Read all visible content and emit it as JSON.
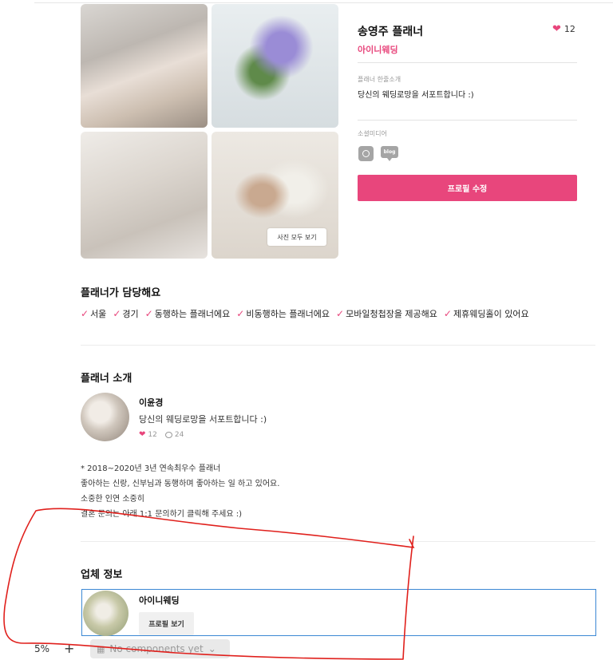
{
  "profile": {
    "planner_name": "송영주 플래너",
    "like_count": "12",
    "company_name": "아이니웨딩",
    "intro_label": "플래너 한줄소개",
    "intro_text": "당신의 웨딩로망을 서포트합니다 :)",
    "social_label": "소셜미디어",
    "blog_icon_text": "blog",
    "edit_button": "프로필 수정"
  },
  "gallery": {
    "view_all_button": "사진 모두 보기"
  },
  "service": {
    "title": "플래너가 담당해요",
    "tags": [
      "서울",
      "경기",
      "동행하는 플래너에요",
      "비동행하는 플래너에요",
      "모바일청첩장을 제공해요",
      "제휴웨딩홀이 있어요"
    ]
  },
  "planner_intro": {
    "title": "플래너 소개",
    "name": "이윤경",
    "description": "당신의 웨딩로망을 서포트합니다 :)",
    "likes": "12",
    "comments": "24",
    "career_lines": [
      "* 2018~2020년 3년 연속최우수 플래너",
      "좋아하는 신랑, 신부님과 동행하며 좋아하는 일 하고 있어요.",
      "소중한 인연 소중히",
      "결혼 문의는 아래 1:1 문의하기 클릭해 주세요 :)"
    ]
  },
  "company_info": {
    "title": "업체 정보",
    "company_name": "아이니웨딩",
    "profile_button": "프로필 보기"
  },
  "editor_toolbar": {
    "zoom": "5%",
    "add": "+",
    "components_placeholder": "No components yet"
  },
  "colors": {
    "accent": "#e8467c",
    "annotation": "#e0201c",
    "selection": "#3b88d4"
  }
}
